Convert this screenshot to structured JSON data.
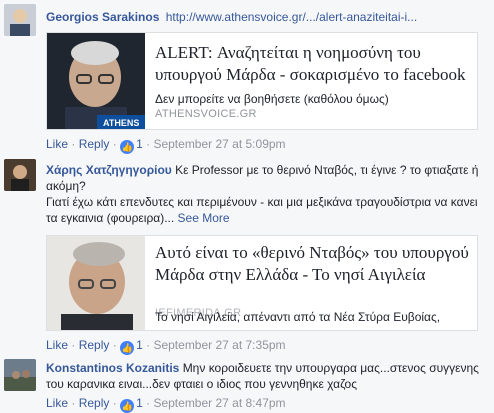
{
  "comments": [
    {
      "author": "Georgios Sarakinos",
      "text": "",
      "link": "http://www.athensvoice.gr/.../alert-anazitеitai-i...",
      "preview": {
        "title": "ALERT: Αναζητείται η νοημοσύνη του υπουργού Μάρδα - σοκαρισμένο το facebook",
        "description": "Δεν μπορείτε να βοηθήσετε (καθόλου όμως)",
        "domain": "ATHENSVOICE.GR",
        "image_caption": "ATHENS"
      },
      "like_label": "Like",
      "reply_label": "Reply",
      "likes": "",
      "time": "September 27 at 5:09pm"
    },
    {
      "author": "Χάρης Χατζηγηγορίου",
      "text": "Κε Professor με το θερινό Νταβός, τι έγινε ? το φτιαξατε ή ακόμη?",
      "text2": "Γιατί έχω κάτι επενδυτες και περιμένουν - και μια μεξικάνα τραγουδίστρια να κανει τα εγκαινια (φουρειρα)...",
      "see_more": "See More",
      "preview": {
        "title": "Αυτό είναι το «θερινό Νταβός» του υπουργού Μάρδα στην Ελλάδα - Το νησί Αιγιλεία",
        "description": "Το νησί Αιγιλεία, απέναντι από τα Νέα Στύρα Ευβοίας,",
        "domain": "IEFIMERIDA.GR"
      },
      "like_label": "Like",
      "reply_label": "Reply",
      "likes": "",
      "time": "September 27 at 7:35pm"
    },
    {
      "author": "Konstantinos Kozanitis",
      "text": "Μην κοροιδευετε την υπουργαρα μας...στενος συγγενης του καρανικα ειναι...δεν φταιει ο ιδιος που γεννηθηκε χαζος",
      "like_label": "Like",
      "reply_label": "Reply",
      "likes": "1",
      "time": "September 27 at 8:47pm"
    }
  ],
  "first_likes": "1",
  "second_likes": "1",
  "sep": "·",
  "like_icon": "thumbs-up-icon"
}
